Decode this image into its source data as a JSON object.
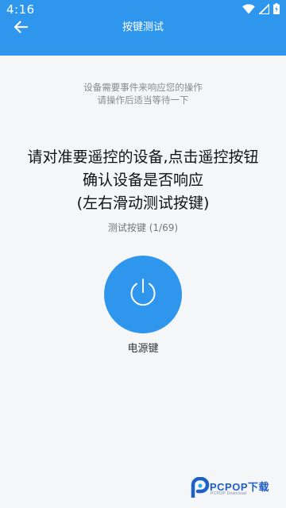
{
  "status_bar": {
    "time": "4:16",
    "icons": [
      "wifi-icon",
      "signal-icon",
      "battery-icon"
    ]
  },
  "toolbar": {
    "title": "按键测试",
    "back_icon": "arrow-left-icon"
  },
  "hint": {
    "line1": "设备需要事件来响应您的操作",
    "line2": "请操作后适当等待一下"
  },
  "instruction": {
    "line1": "请对准要遥控的设备,点击遥控按钮",
    "line2": "确认设备是否响应",
    "line3": "(左右滑动测试按键)"
  },
  "counter": "测试按键 (1/69)",
  "power_button": {
    "icon": "power-icon",
    "label": "电源键"
  },
  "watermark": {
    "logo_text": "PCPOP下载",
    "sub_text": "PCPOP Download"
  },
  "colors": {
    "primary": "#2f96ee",
    "background": "#f5f6f8"
  }
}
